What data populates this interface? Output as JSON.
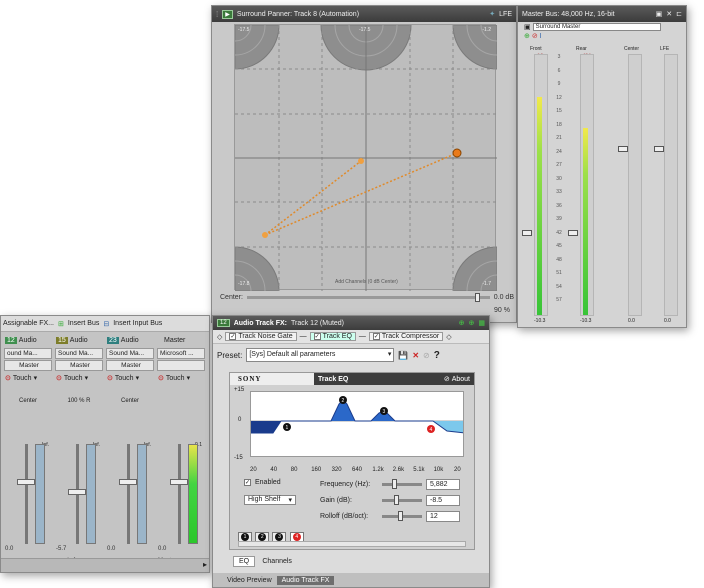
{
  "panner": {
    "title": "Surround Panner: Track 8 (Automation)",
    "lfe_label": "LFE",
    "corner_values": [
      "-17.5",
      "-17.5",
      "-1.2",
      "-17.8",
      "-1.7"
    ],
    "center_caption": "Add Channels (0 dB Center)",
    "center_label": "Center:",
    "center_value": "0.0 dB",
    "pct_value": "90 %"
  },
  "master_bus": {
    "title": "Master Bus: 48,000 Hz, 16-bit",
    "name_field": "Surround Master",
    "channels": [
      {
        "label": "Front",
        "peak_l": "-Inf.",
        "peak_r": "-6.3",
        "level": 0.84,
        "foot_l": "-10.3",
        "foot_r": "-10.3"
      },
      {
        "label": "Rear",
        "peak_l": "-Inf.",
        "peak_r": "-12.1",
        "level": 0.72,
        "foot_l": "-10.3",
        "foot_r": "-10.2"
      },
      {
        "label": "Center",
        "peak_l": "-Inf.",
        "peak_r": "",
        "level": 0.0,
        "foot_l": "0.0",
        "foot_r": ""
      },
      {
        "label": "LFE",
        "peak_l": "-Inf.",
        "peak_r": "",
        "level": 0.0,
        "foot_l": "0.0",
        "foot_r": ""
      }
    ],
    "scale": [
      "3",
      "6",
      "9",
      "12",
      "15",
      "18",
      "21",
      "24",
      "27",
      "30",
      "33",
      "36",
      "39",
      "42",
      "45",
      "48",
      "51",
      "54",
      "57"
    ]
  },
  "mixer": {
    "toolbar": [
      "Assignable FX...",
      "Insert Bus",
      "Insert Input Bus"
    ],
    "strips": [
      {
        "num": "12",
        "name": "Audio",
        "plugin": "ound Ma...",
        "bus": "Master",
        "mode": "Touch",
        "pan": "Center",
        "peak": "-Inf.",
        "foot": "0.0",
        "color": "#3f8f4f"
      },
      {
        "num": "15",
        "name": "Audio",
        "plugin": "Sound Ma...",
        "bus": "Master",
        "mode": "Touch",
        "pan": "100 % R",
        "peak": "-Inf.",
        "foot": "-5.7",
        "footname": "music from ...",
        "color": "#7d7d2a"
      },
      {
        "num": "23",
        "name": "Audio",
        "plugin": "Sound Ma...",
        "bus": "Master",
        "mode": "Touch",
        "pan": "Center",
        "peak": "-Inf.",
        "foot": "0.0",
        "color": "#2f7f7f"
      },
      {
        "num": "",
        "name": "Master",
        "plugin": "Microsoft ...",
        "bus": "",
        "mode": "Touch",
        "pan": "",
        "peak": "-0.1",
        "foot": "0.0",
        "footname": "Master",
        "color": "#666666"
      }
    ]
  },
  "fx": {
    "badge": "12",
    "title": "Audio Track FX:",
    "track": "Track 12 (Muted)",
    "chain": [
      "Track Noise Gate",
      "Track EQ",
      "Track Compressor"
    ],
    "preset_label": "Preset:",
    "preset_value": "[Sys] Default all parameters",
    "brand": "SONY",
    "plugin_name": "Track EQ",
    "about": "About",
    "y_ticks": [
      "+15",
      "0",
      "-15"
    ],
    "x_ticks": [
      "20",
      "40",
      "80",
      "160",
      "320",
      "640",
      "1.2k",
      "2.6k",
      "5.1k",
      "10k",
      "20"
    ],
    "enabled_label": "Enabled",
    "filter_type": "High Shelf",
    "freq_label": "Frequency (Hz):",
    "freq_value": "5,882",
    "gain_label": "Gain (dB):",
    "gain_value": "-8.5",
    "rolloff_label": "Rolloff (dB/oct):",
    "rolloff_value": "12",
    "bands": [
      "1",
      "2",
      "3",
      "4"
    ],
    "tabs": [
      "EQ",
      "Channels"
    ],
    "bottom_tabs": [
      "Video Preview",
      "Audio Track FX"
    ]
  }
}
